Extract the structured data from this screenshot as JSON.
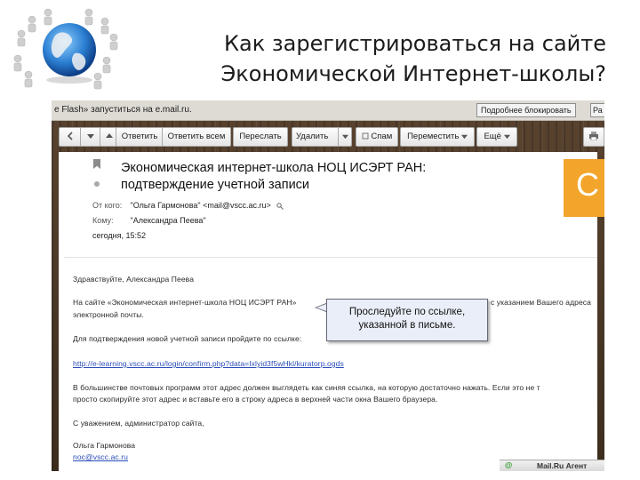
{
  "slide": {
    "title_line1": "Как зарегистрироваться на сайте",
    "title_line2": "Экономической Интернет-школы?"
  },
  "flash_bar": {
    "message": "е Flash» запуститься на e.mail.ru.",
    "allow_button": "Подробнее блокировать",
    "close_button": "Ра"
  },
  "toolbar": {
    "reply": "Ответить",
    "reply_all": "Ответить всем",
    "forward": "Переслать",
    "delete": "Удалить",
    "spam": "Спам",
    "move": "Переместить",
    "more": "Ещё"
  },
  "email": {
    "subject_line1": "Экономическая интернет-школа НОЦ ИСЭРТ РАН:",
    "subject_line2": "подтверждение учетной записи",
    "from_label": "От кого:",
    "from_value": "\"Ольга Гармонова\" <mail@vscc.ac.ru>",
    "to_label": "Кому:",
    "to_value": "\"Александра Пеева\"",
    "date_value": "сегодня, 15:52",
    "orange_letter": "С",
    "body": {
      "greeting": "Здравствуйте, Александра Пеева",
      "p1_left": "На сайте «Экономическая интернет-школа НОЦ ИСЭРТ РАН»",
      "p1_right": "с указанием Вашего адреса",
      "p1_line2": "электронной почты.",
      "p2": "Для подтверждения новой учетной записи пройдите по ссылке:",
      "link": "http://e-learning.vscc.ac.ru/login/confirm.php?data=Ixlyid3f5wHkl/kuratorp.ogds",
      "p3_line1": "В большинстве почтовых программ этот адрес должен выглядеть как синяя ссылка, на которую достаточно нажать. Если это не т",
      "p3_line2": "просто скопируйте этот адрес и вставьте его в строку адреса в верхней части окна Вашего браузера.",
      "regards": "С уважением, администратор сайта,",
      "sign_name": "Ольга Гармонова",
      "sign_email": "noc@vscc.ac.ru"
    }
  },
  "callout": {
    "line1": "Проследуйте по ссылке,",
    "line2": "указанной в письме."
  },
  "agent_bar": {
    "icon": "@",
    "label": "Mail.Ru Агент"
  }
}
